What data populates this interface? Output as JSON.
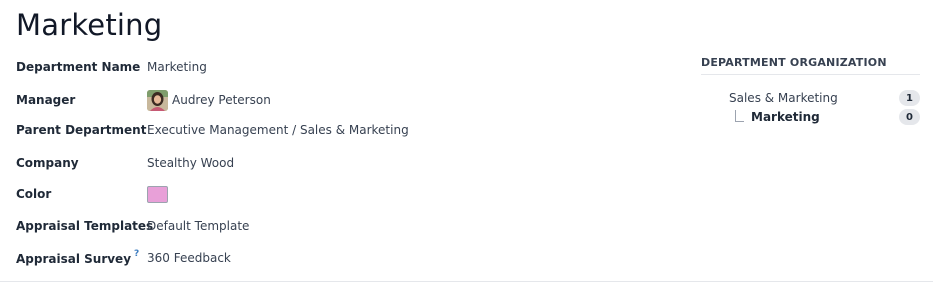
{
  "page": {
    "title": "Marketing"
  },
  "form": {
    "department_name": {
      "label": "Department Name",
      "value": "Marketing"
    },
    "manager": {
      "label": "Manager",
      "value": "Audrey Peterson"
    },
    "parent_department": {
      "label": "Parent Department",
      "value": "Executive Management / Sales & Marketing"
    },
    "company": {
      "label": "Company",
      "value": "Stealthy Wood"
    },
    "color": {
      "label": "Color",
      "value": "#e8a0d8"
    },
    "appraisal_templates": {
      "label": "Appraisal Templates",
      "value": "Default Template"
    },
    "appraisal_survey": {
      "label": "Appraisal Survey",
      "help": "?",
      "value": "360 Feedback"
    }
  },
  "org": {
    "title": "DEPARTMENT ORGANIZATION",
    "items": [
      {
        "name": "Sales & Marketing",
        "count": "1"
      },
      {
        "name": "Marketing",
        "count": "0"
      }
    ]
  },
  "icons": {
    "avatar": "user-avatar-photo",
    "help": "help-tooltip-icon"
  }
}
